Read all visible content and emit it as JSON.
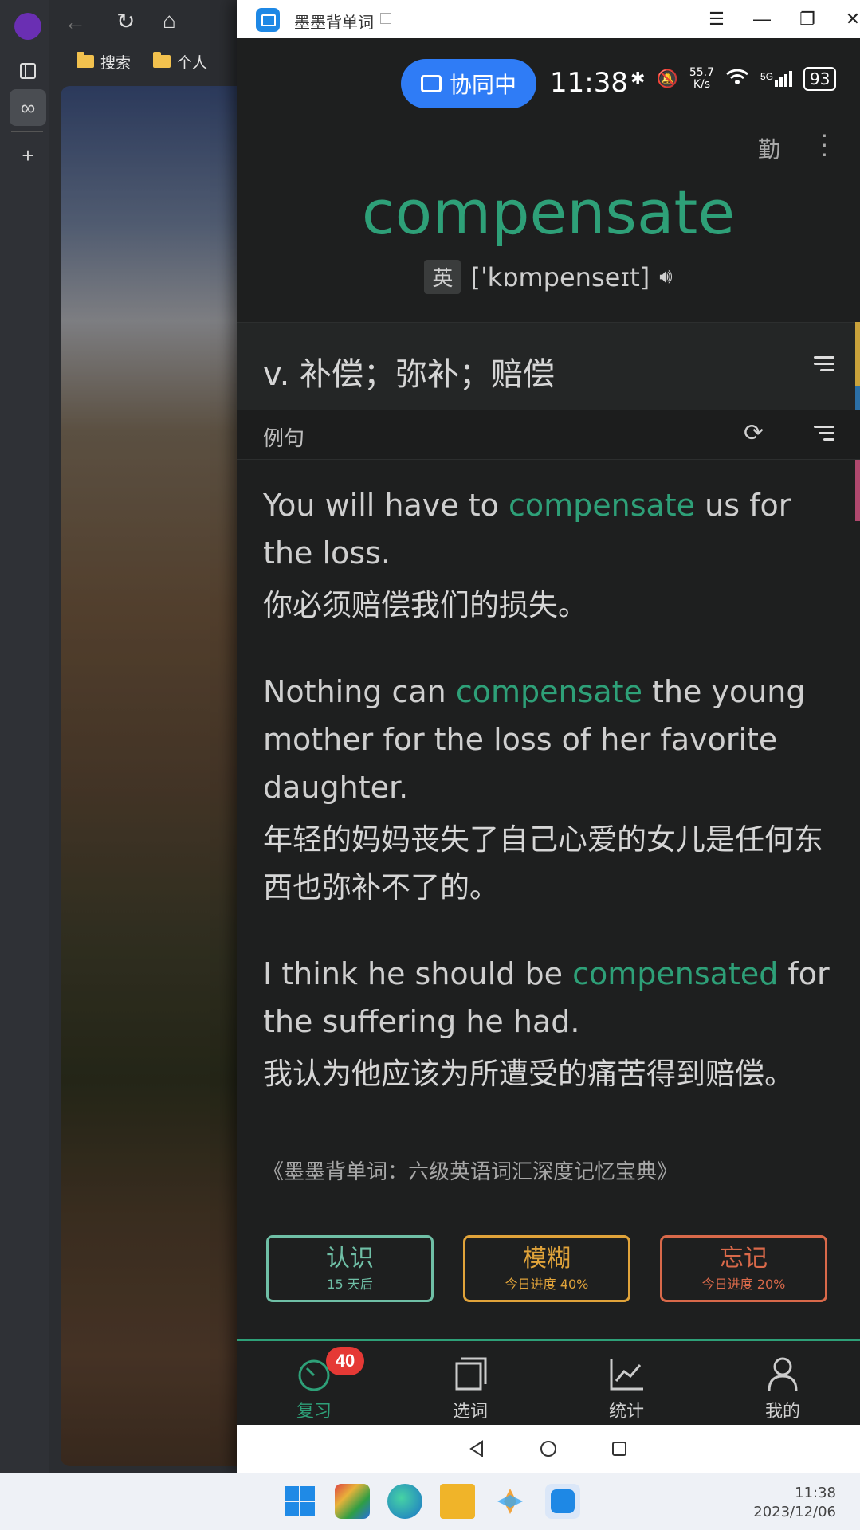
{
  "browser": {
    "bookmarks": [
      "搜索",
      "个人"
    ]
  },
  "window": {
    "title": "墨墨背单词",
    "controls": [
      "☰",
      "—",
      "❐",
      "✕"
    ]
  },
  "status": {
    "collab_label": "协同中",
    "time": "11:38",
    "net_speed_top": "55.7",
    "net_speed_unit": "K/s",
    "signal": "5G",
    "battery": "93"
  },
  "word": {
    "text": "compensate",
    "region": "英",
    "phonetic": "[ˈkɒmpenseɪt]",
    "meaning": "v. 补偿；弥补；赔偿"
  },
  "examples_section": {
    "label": "例句",
    "items": [
      {
        "pre": "You will have to ",
        "hl": "compensate",
        "post": " us for the loss.",
        "cn": "你必须赔偿我们的损失。"
      },
      {
        "pre": "Nothing can ",
        "hl": "compensate",
        "post": " the young mother for the loss of her favorite daughter.",
        "cn": "年轻的妈妈丧失了自己心爱的女儿是任何东西也弥补不了的。"
      },
      {
        "pre": "I think he should be ",
        "hl": "compensated",
        "post": " for the suffering he had.",
        "cn": "我认为他应该为所遭受的痛苦得到赔偿。"
      }
    ],
    "source": "《墨墨背单词：六级英语词汇深度记忆宝典》"
  },
  "actions": [
    {
      "label": "认识",
      "sub": "15 天后",
      "color": "#6fbfa6"
    },
    {
      "label": "模糊",
      "sub": "今日进度 40%",
      "color": "#e0a33a"
    },
    {
      "label": "忘记",
      "sub": "今日进度 20%",
      "color": "#d9694a"
    }
  ],
  "tabs": [
    {
      "label": "复习",
      "icon": "review-timer-icon",
      "active": true
    },
    {
      "label": "选词",
      "icon": "cards-icon",
      "active": false
    },
    {
      "label": "统计",
      "icon": "chart-icon",
      "active": false
    },
    {
      "label": "我的",
      "icon": "person-icon",
      "active": false
    }
  ],
  "review_badge": "40",
  "taskbar": {
    "time": "11:38",
    "date": "2023/12/06"
  },
  "colors": {
    "accent_green": "#2ea078",
    "collab_blue": "#2f7cf6",
    "badge_red": "#e53935"
  }
}
